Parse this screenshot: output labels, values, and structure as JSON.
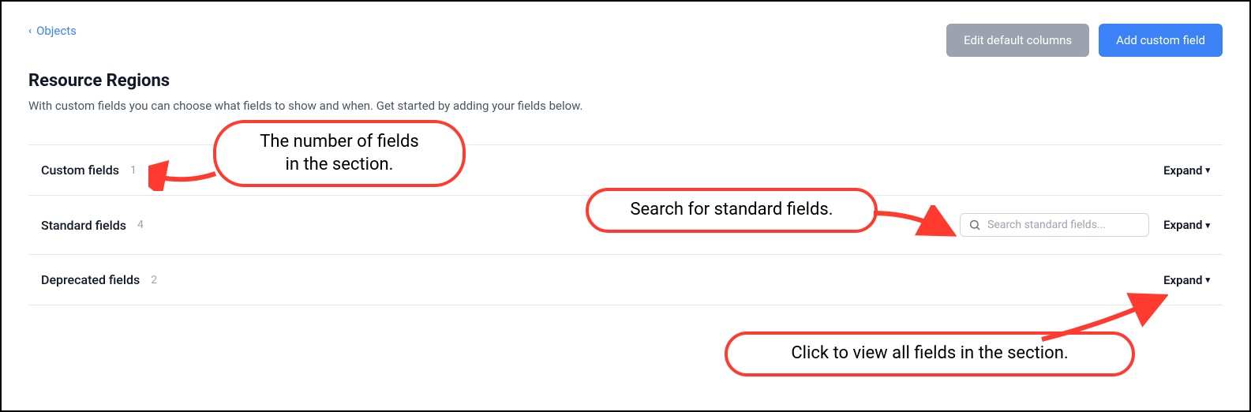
{
  "breadcrumb": {
    "label": "Objects"
  },
  "header": {
    "edit_columns_label": "Edit default columns",
    "add_field_label": "Add custom field"
  },
  "page": {
    "title": "Resource Regions",
    "subtitle": "With custom fields you can choose what fields to show and when. Get started by adding your fields below."
  },
  "sections": [
    {
      "title": "Custom fields",
      "count": "1",
      "expand_label": "Expand",
      "has_search": false
    },
    {
      "title": "Standard fields",
      "count": "4",
      "expand_label": "Expand",
      "has_search": true,
      "search_placeholder": "Search standard fields..."
    },
    {
      "title": "Deprecated fields",
      "count": "2",
      "expand_label": "Expand",
      "has_search": false
    }
  ],
  "annotations": {
    "count_callout": "The number of fields\nin the section.",
    "search_callout": "Search for standard fields.",
    "expand_callout": "Click to view all fields in the section."
  }
}
